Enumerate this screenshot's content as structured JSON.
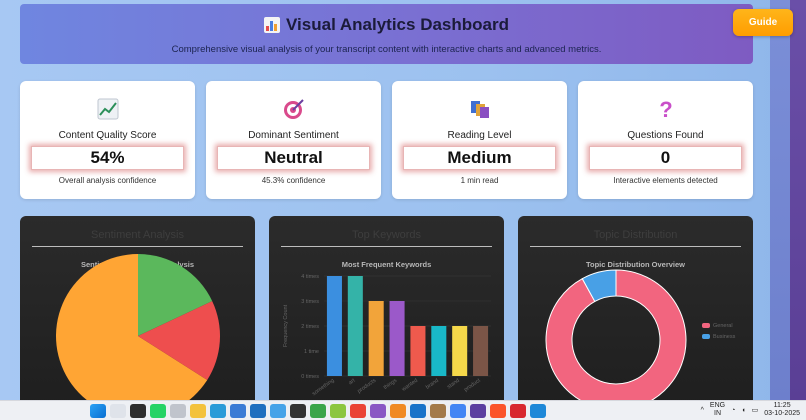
{
  "header": {
    "title": "Visual Analytics Dashboard",
    "subtitle": "Comprehensive visual analysis of your transcript content with interactive charts and advanced metrics."
  },
  "guide_button": {
    "label": "Guide"
  },
  "cards": [
    {
      "label": "Content Quality Score",
      "value": "54%",
      "sub": "Overall analysis confidence",
      "icon": "chart-trend-icon"
    },
    {
      "label": "Dominant Sentiment",
      "value": "Neutral",
      "sub": "45.3% confidence",
      "icon": "target-icon"
    },
    {
      "label": "Reading Level",
      "value": "Medium",
      "sub": "1 min read",
      "icon": "books-icon"
    },
    {
      "label": "Questions Found",
      "value": "0",
      "sub": "Interactive elements detected",
      "icon": "question-icon"
    }
  ],
  "panels": [
    {
      "title": "Sentiment Analysis",
      "chart_title": "Sentiment Distribution Analysis"
    },
    {
      "title": "Top Keywords",
      "chart_title": "Most Frequent Keywords"
    },
    {
      "title": "Topic Distribution",
      "chart_title": "Topic Distribution Overview"
    }
  ],
  "chart_data": [
    {
      "type": "pie",
      "title": "Sentiment Distribution Analysis",
      "slices": [
        {
          "value": 66,
          "color": "#ffa534"
        },
        {
          "value": 18,
          "color": "#5bb85c"
        },
        {
          "value": 16,
          "color": "#ee4e4e"
        }
      ]
    },
    {
      "type": "bar",
      "title": "Most Frequent Keywords",
      "ylabel": "Frequency Count",
      "yticks": [
        "0 times",
        "1 time",
        "2 times",
        "3 times",
        "4 times"
      ],
      "ylim": [
        0,
        4
      ],
      "categories": [
        "something",
        "art",
        "products",
        "things",
        "wanted",
        "brand",
        "stand",
        "product"
      ],
      "values": [
        4,
        4,
        3,
        3,
        2,
        2,
        2,
        2
      ],
      "colors": [
        "#3b8fe0",
        "#34b3a8",
        "#f2a43a",
        "#9b59c9",
        "#ef5a4d",
        "#19b8c8",
        "#f5d84a",
        "#7b5547"
      ]
    },
    {
      "type": "pie",
      "donut": true,
      "title": "Topic Distribution Overview",
      "legend": [
        "General",
        "Business"
      ],
      "legend_position": "right",
      "slices": [
        {
          "value": 92,
          "color": "#f2657f"
        },
        {
          "value": 8,
          "color": "#48a0e6"
        }
      ]
    }
  ],
  "taskbar": {
    "lang_top": "ENG",
    "lang_bottom": "IN",
    "time": "11:25",
    "date": "03-10-2025"
  }
}
